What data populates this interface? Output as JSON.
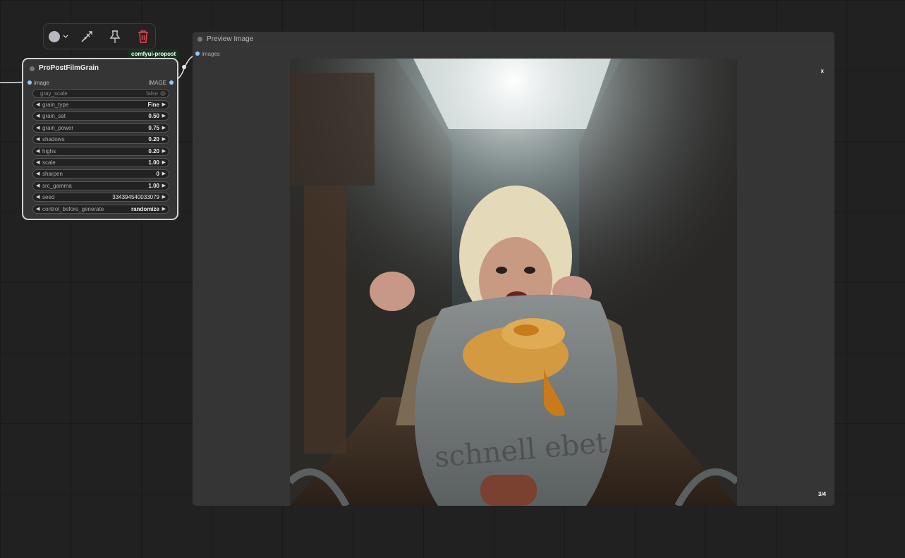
{
  "toolbox": {
    "color_icon": "color-circle-icon",
    "dropdown_icon": "chevron-down-icon",
    "bypass_icon": "bypass-wand-icon",
    "pin_icon": "pin-icon",
    "delete_icon": "trash-icon",
    "delete_color": "#e0484c"
  },
  "node": {
    "title": "ProPostFilmGrain",
    "badge": "comfyui-propost",
    "input_label": "image",
    "output_label": "IMAGE",
    "widgets": [
      {
        "label": "gray_scale",
        "value": "false"
      },
      {
        "label": "grain_type",
        "value": "Fine"
      },
      {
        "label": "grain_sat",
        "value": "0.50"
      },
      {
        "label": "grain_power",
        "value": "0.75"
      },
      {
        "label": "shadows",
        "value": "0.20"
      },
      {
        "label": "highs",
        "value": "0.20"
      },
      {
        "label": "scale",
        "value": "1.00"
      },
      {
        "label": "sharpen",
        "value": "0"
      },
      {
        "label": "src_gamma",
        "value": "1.00"
      },
      {
        "label": "seed",
        "value": "334394540033079"
      },
      {
        "label": "control_before_generate",
        "value": "randomize"
      }
    ]
  },
  "preview": {
    "title": "Preview Image",
    "input_label": "images",
    "close_label": "x",
    "counter": "3/4",
    "image_text": "schnell ebet"
  },
  "colors": {
    "canvas": "#212121",
    "node_bg": "#353535",
    "slot": "#8ecbff",
    "badge_bg": "#16331e"
  }
}
